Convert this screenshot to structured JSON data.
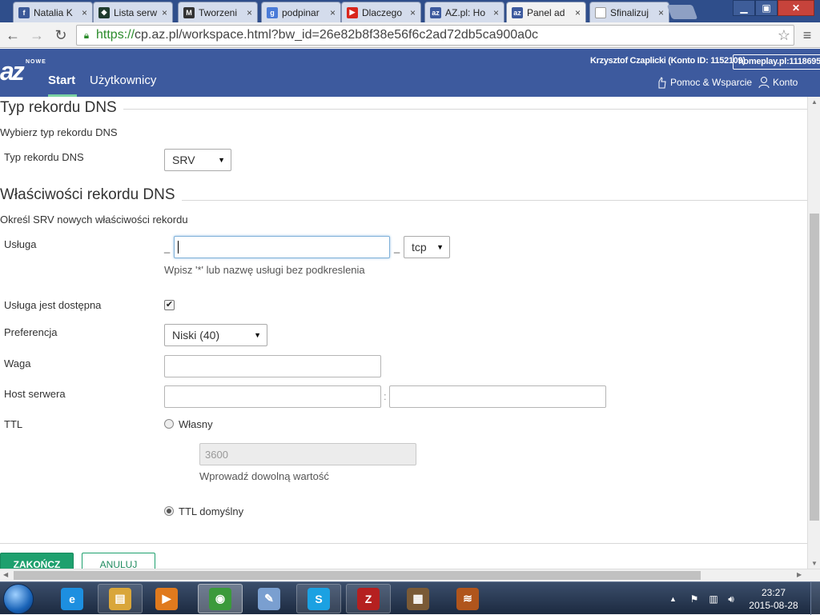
{
  "browser": {
    "tabs": [
      {
        "label": "Natalia K",
        "favicon": "facebook-icon",
        "color": "#3b5998",
        "glyph": "f"
      },
      {
        "label": "Lista serw",
        "favicon": "shield-icon",
        "color": "#1f3b2e",
        "glyph": "◆"
      },
      {
        "label": "Tworzeni",
        "favicon": "mpc-icon",
        "color": "#333333",
        "glyph": "M"
      },
      {
        "label": "podpinar",
        "favicon": "google-icon",
        "color": "#4a7bd8",
        "glyph": "g"
      },
      {
        "label": "Dlaczego",
        "favicon": "youtube-icon",
        "color": "#d9261c",
        "glyph": "▶"
      },
      {
        "label": "AZ.pl: Ho",
        "favicon": "az-icon",
        "color": "#3d5a9e",
        "glyph": "az"
      },
      {
        "label": "Panel ad",
        "favicon": "az-icon",
        "color": "#3d5a9e",
        "glyph": "az"
      },
      {
        "label": "Sfinalizuj",
        "favicon": "page-icon",
        "color": "#ffffff",
        "glyph": ""
      }
    ],
    "url_scheme": "https://",
    "url_rest": "cp.az.pl/workspace.html?bw_id=26e82b8f38e56f6c2ad72db5ca900a0c",
    "back_icon": "arrow-left-icon",
    "forward_icon": "arrow-right-icon",
    "reload_icon": "reload-icon"
  },
  "header": {
    "logo_small": "NOWE",
    "logo_text": "az",
    "nav_start": "Start",
    "nav_users": "Użytkownicy",
    "user_info": "Krzysztof Czaplicki (Konto ID: 1152109)",
    "domain": "homeplay.pl:1118695",
    "help_label": "Pomoc & Wsparcie",
    "account_label": "Konto",
    "accent_color": "#3d5a9e"
  },
  "form": {
    "section1_title": "Typ rekordu DNS",
    "section1_subtitle": "Wybierz typ rekordu DNS",
    "record_type_label": "Typ rekordu DNS",
    "record_type_value": "SRV",
    "section2_title": "Właściwości rekordu DNS",
    "section2_subtitle": "Określ SRV nowych właściwości rekordu",
    "service_label": "Usługa",
    "service_prefix": "_",
    "service_value": "",
    "service_sep": "_",
    "protocol_value": "tcp",
    "service_hint": "Wpisz '*' lub nazwę usługi bez podkreslenia",
    "available_label": "Usługa jest dostępna",
    "available_checked": "✔",
    "preference_label": "Preferencja",
    "preference_value": "Niski (40)",
    "weight_label": "Waga",
    "host_label": "Host serwera",
    "host_sep": ":",
    "ttl_label": "TTL",
    "ttl_custom_label": "Własny",
    "ttl_custom_value": "3600",
    "ttl_custom_hint": "Wprowadź dowolną wartość",
    "ttl_default_label": "TTL domyślny",
    "finish_button": "ZAKOŃCZ",
    "cancel_button": "ANULUJ",
    "button_color": "#1ea06e"
  },
  "taskbar": {
    "apps": [
      {
        "name": "ie-icon",
        "glyph": "e",
        "color": "#1d8fe0"
      },
      {
        "name": "explorer-icon",
        "glyph": "▤",
        "color": "#d9a63a"
      },
      {
        "name": "media-player-icon",
        "glyph": "▶",
        "color": "#e07a1d"
      },
      {
        "name": "chrome-icon",
        "glyph": "◉",
        "color": "#3b9a3b"
      },
      {
        "name": "paint-icon",
        "glyph": "✎",
        "color": "#7a9fd0"
      },
      {
        "name": "skype-icon",
        "glyph": "S",
        "color": "#1ba1e2"
      },
      {
        "name": "filezilla-icon",
        "glyph": "Z",
        "color": "#b52020"
      },
      {
        "name": "minecraft-icon",
        "glyph": "▦",
        "color": "#7a5a36"
      },
      {
        "name": "coil-app-icon",
        "glyph": "≋",
        "color": "#b0551c"
      }
    ],
    "time": "23:27",
    "date": "2015-08-28"
  }
}
